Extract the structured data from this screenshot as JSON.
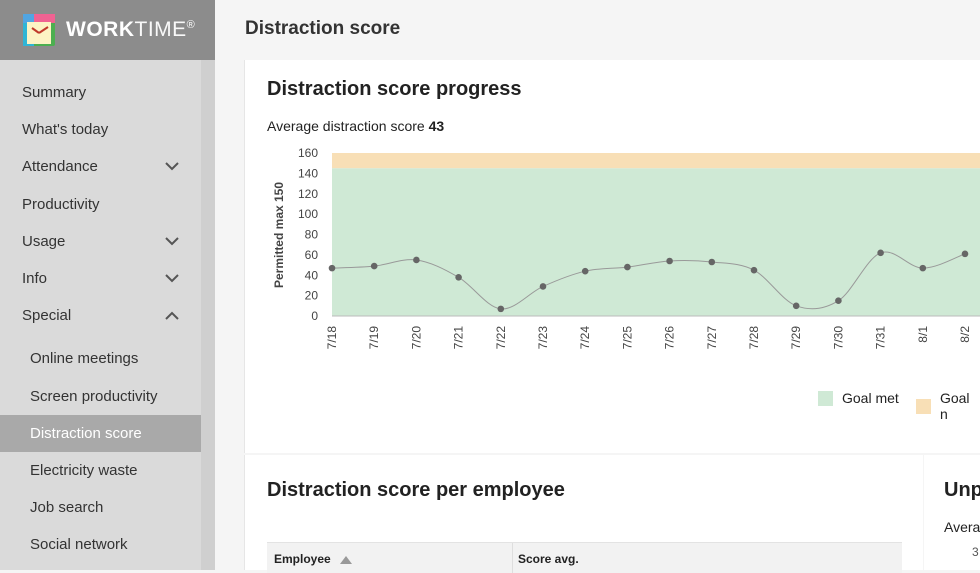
{
  "app": {
    "brand_bold": "WORK",
    "brand_thin": "TIME",
    "brand_mark": "®"
  },
  "header": {
    "title": "Distraction score"
  },
  "sidebar": {
    "items": [
      {
        "label": "Summary",
        "chevron": ""
      },
      {
        "label": "What's today",
        "chevron": ""
      },
      {
        "label": "Attendance",
        "chevron": "down"
      },
      {
        "label": "Productivity",
        "chevron": ""
      },
      {
        "label": "Usage",
        "chevron": "down"
      },
      {
        "label": "Info",
        "chevron": "down"
      },
      {
        "label": "Special",
        "chevron": "up"
      }
    ],
    "sub_items": [
      {
        "label": "Online meetings"
      },
      {
        "label": "Screen productivity"
      },
      {
        "label": "Distraction score",
        "active": true
      },
      {
        "label": "Electricity waste"
      },
      {
        "label": "Job search"
      },
      {
        "label": "Social network"
      }
    ]
  },
  "progress_panel": {
    "title": "Distraction score progress",
    "avg_label": "Average distraction score",
    "avg_value": "43",
    "legend": [
      {
        "label": "Goal met",
        "color": "#cfe9d5"
      },
      {
        "label": "Goal n",
        "color": "#f8dfb6"
      }
    ]
  },
  "chart_data": {
    "type": "line",
    "ylabel": "Permitted max 150",
    "ylim": [
      0,
      160
    ],
    "yticks": [
      0,
      20,
      40,
      60,
      80,
      100,
      120,
      140,
      160
    ],
    "goal_threshold": 145,
    "categories": [
      "7/18",
      "7/19",
      "7/20",
      "7/21",
      "7/22",
      "7/23",
      "7/24",
      "7/25",
      "7/26",
      "7/27",
      "7/28",
      "7/29",
      "7/30",
      "7/31",
      "8/1",
      "8/2"
    ],
    "values": [
      47,
      49,
      55,
      38,
      7,
      29,
      44,
      48,
      54,
      53,
      45,
      10,
      15,
      62,
      47,
      61
    ],
    "colors": {
      "goal_met": "#cfe9d5",
      "goal_not_met": "#f8dfb6",
      "line": "#999999",
      "point": "#666666"
    }
  },
  "employee_panel": {
    "title": "Distraction score per employee",
    "columns": [
      "Employee",
      "Score avg."
    ]
  },
  "right_panel": {
    "title": "Unp",
    "subtitle": "Avera",
    "value": "3"
  }
}
